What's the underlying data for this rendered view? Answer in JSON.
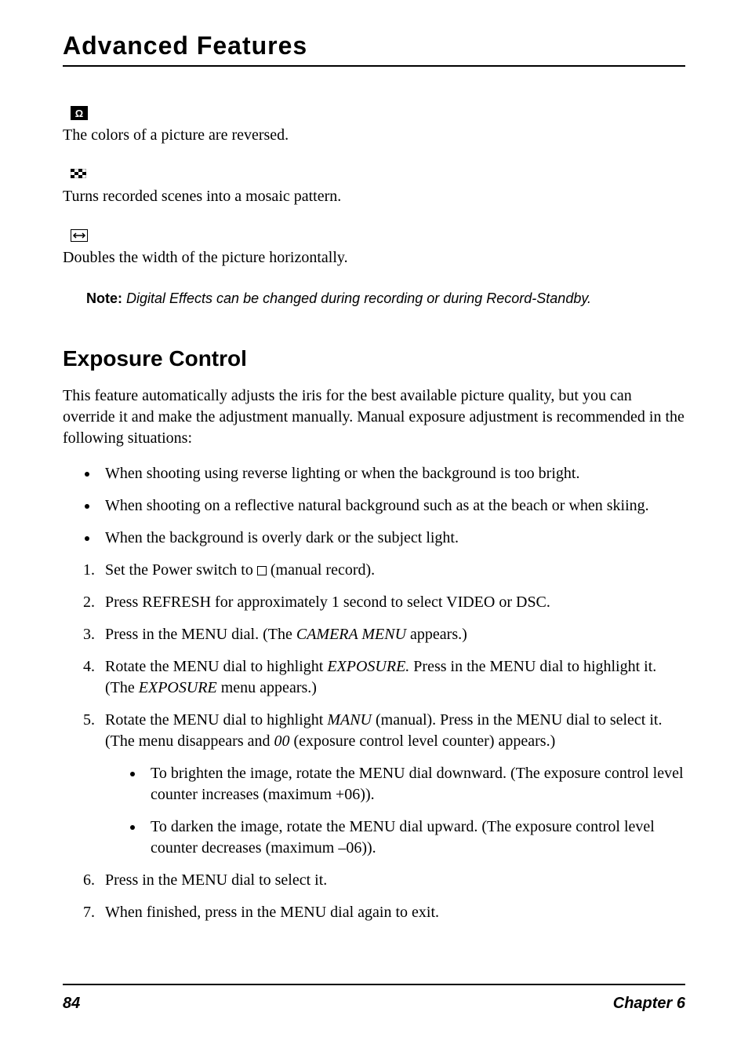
{
  "chapter_title": "Advanced Features",
  "effects": {
    "negposi": {
      "icon_label": "Ω",
      "desc": "The colors of a picture are reversed."
    },
    "mosaic": {
      "desc": "Turns recorded scenes into a mosaic pattern."
    },
    "stretch": {
      "icon_glyph": "↔",
      "desc": "Doubles the width of the picture horizontally."
    }
  },
  "note": {
    "label": "Note:",
    "text": " Digital Effects can be changed during recording or during Record-Standby."
  },
  "section": {
    "heading": "Exposure Control",
    "intro": "This feature automatically adjusts the iris for the best available picture quality, but you can override it and make the adjustment manually. Manual exposure adjustment is recommended in the following situations:",
    "bullets": [
      "When shooting using reverse lighting or when the background is too bright.",
      "When shooting on a reflective natural background such as at the beach or when skiing.",
      "When the background is overly dark or the subject light."
    ],
    "steps": {
      "s1_a": "Set the Power switch to ",
      "s1_b": " (manual record).",
      "s2": "Press REFRESH for approximately 1 second to select VIDEO or DSC.",
      "s3_a": "Press in the MENU dial. (The ",
      "s3_em": "CAMERA MENU",
      "s3_b": " appears.)",
      "s4_a": "Rotate the MENU dial to highlight ",
      "s4_em1": "EXPOSURE.",
      "s4_b": " Press in the MENU dial to highlight it. (The ",
      "s4_em2": "EXPOSURE",
      "s4_c": " menu appears.)",
      "s5_a": "Rotate the MENU dial to highlight ",
      "s5_em1": "MANU",
      "s5_b": " (manual). Press in the MENU dial to select it. (The menu disappears and ",
      "s5_em2": "00",
      "s5_c": " (exposure control level counter) appears.)",
      "s5_sub1": "To brighten the image, rotate the MENU dial downward. (The exposure control level counter increases (maximum +06)).",
      "s5_sub2": "To darken the image, rotate the MENU dial upward. (The exposure control level counter decreases (maximum –06)).",
      "s6": "Press in the MENU dial to select it.",
      "s7": "When finished, press in the MENU dial again to exit."
    }
  },
  "footer": {
    "page": "84",
    "chapter": "Chapter 6"
  }
}
